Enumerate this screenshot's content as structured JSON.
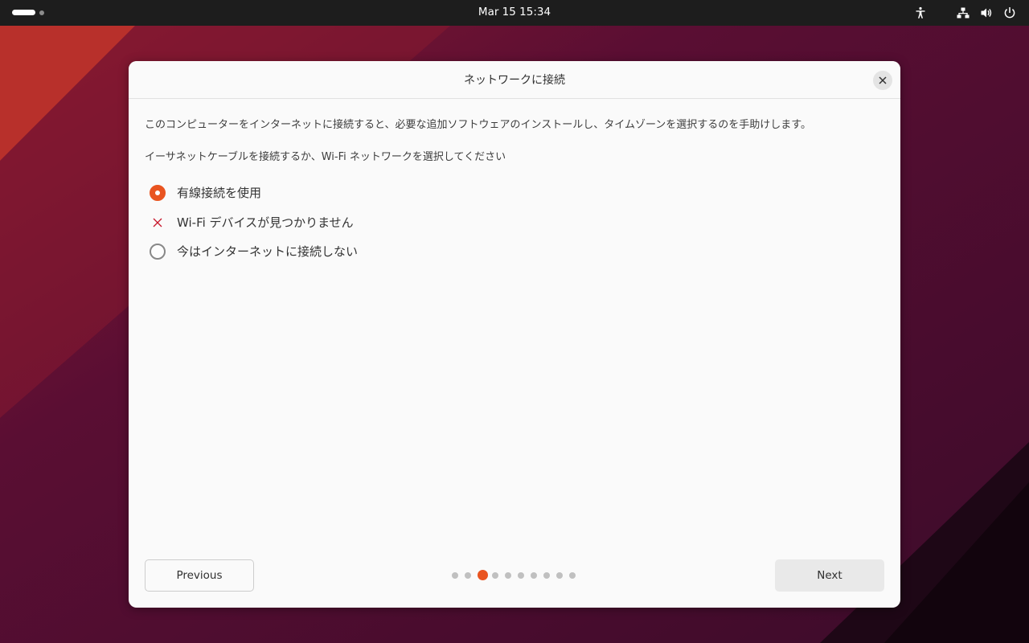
{
  "topbar": {
    "clock": "Mar 15  15:34",
    "icons": [
      "accessibility-icon",
      "network-wired-icon",
      "volume-icon",
      "power-icon"
    ]
  },
  "dialog": {
    "title": "ネットワークに接続",
    "description": "このコンピューターをインターネットに接続すると、必要な追加ソフトウェアのインストールし、タイムゾーンを選択するのを手助けします。",
    "instruction": "イーサネットケーブルを接続するか、Wi-Fi ネットワークを選択してください",
    "options": [
      {
        "label": "有線接続を使用",
        "state": "selected"
      },
      {
        "label": "Wi-Fi デバイスが見つかりません",
        "state": "unavailable"
      },
      {
        "label": "今はインターネットに接続しない",
        "state": "unselected"
      }
    ],
    "previous_label": "Previous",
    "next_label": "Next",
    "pager": {
      "total": 10,
      "current": 3
    }
  },
  "colors": {
    "accent": "#e95420",
    "error": "#c7162b",
    "topbar": "#1d1d1d"
  }
}
